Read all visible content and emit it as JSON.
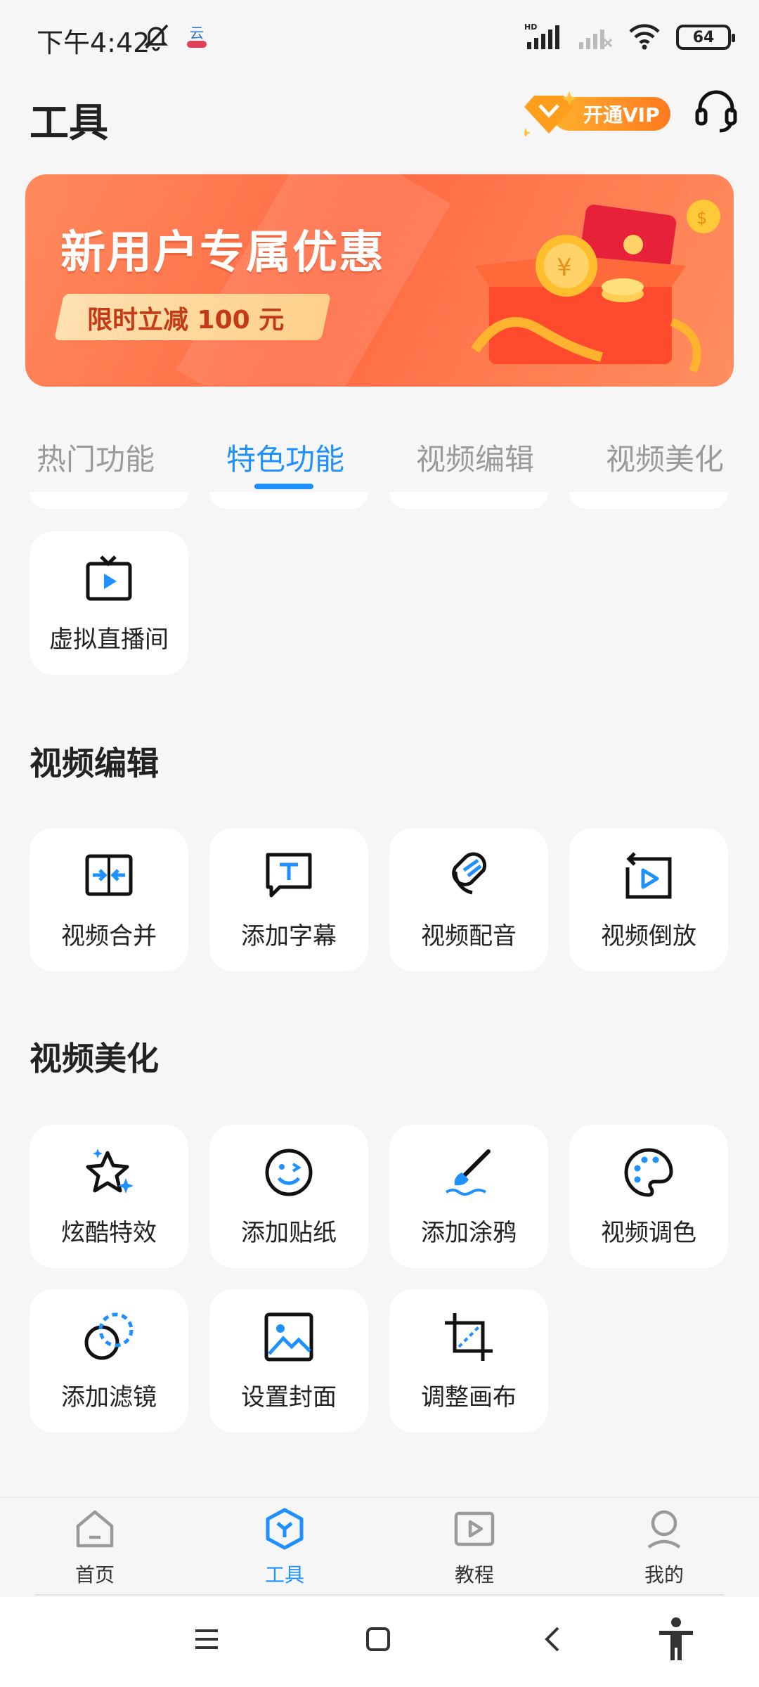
{
  "status_bar": {
    "time": "下午4:42",
    "battery": "64",
    "signal_label": "HD"
  },
  "header": {
    "title": "工具",
    "vip_label": "开通VIP"
  },
  "banner": {
    "title": "新用户专属优惠",
    "subtitle": "限时立减 100 元"
  },
  "tabs": [
    {
      "label": "热门功能",
      "active": false
    },
    {
      "label": "特色功能",
      "active": true
    },
    {
      "label": "视频编辑",
      "active": false
    },
    {
      "label": "视频美化",
      "active": false
    }
  ],
  "featured": {
    "items": [
      {
        "label": "虚拟直播间",
        "icon": "tv-play-icon"
      }
    ]
  },
  "video_edit": {
    "title": "视频编辑",
    "items": [
      {
        "label": "视频合并",
        "icon": "merge-icon"
      },
      {
        "label": "添加字幕",
        "icon": "subtitle-icon"
      },
      {
        "label": "视频配音",
        "icon": "dubbing-icon"
      },
      {
        "label": "视频倒放",
        "icon": "reverse-icon"
      }
    ]
  },
  "video_beautify": {
    "title": "视频美化",
    "items": [
      {
        "label": "炫酷特效",
        "icon": "star-effect-icon"
      },
      {
        "label": "添加贴纸",
        "icon": "sticker-icon"
      },
      {
        "label": "添加涂鸦",
        "icon": "brush-icon"
      },
      {
        "label": "视频调色",
        "icon": "palette-icon"
      },
      {
        "label": "添加滤镜",
        "icon": "filter-icon"
      },
      {
        "label": "设置封面",
        "icon": "cover-image-icon"
      },
      {
        "label": "调整画布",
        "icon": "crop-canvas-icon"
      }
    ]
  },
  "bottom_nav": [
    {
      "label": "首页",
      "icon": "home-icon",
      "active": false
    },
    {
      "label": "工具",
      "icon": "tools-icon",
      "active": true
    },
    {
      "label": "教程",
      "icon": "tutorial-icon",
      "active": false
    },
    {
      "label": "我的",
      "icon": "profile-icon",
      "active": false
    }
  ],
  "colors": {
    "accent": "#1e90ff",
    "banner": "#ff6b45",
    "vip": "#ff9a26"
  }
}
